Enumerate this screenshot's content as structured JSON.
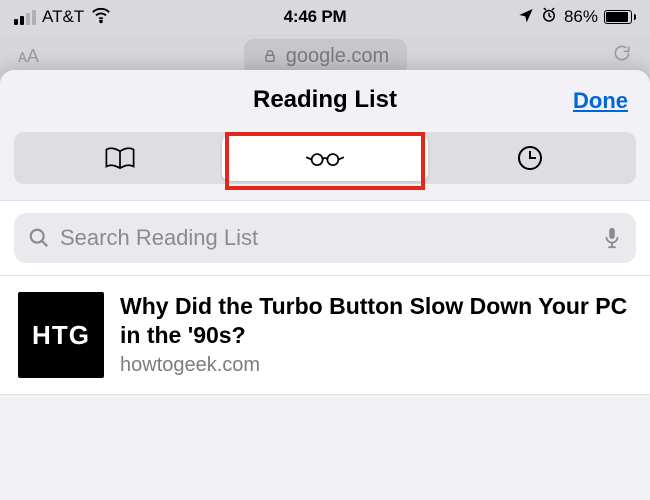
{
  "status": {
    "carrier": "AT&T",
    "time": "4:46 PM",
    "battery_pct": "86%"
  },
  "safari": {
    "url": "google.com"
  },
  "sheet": {
    "title": "Reading List",
    "done_label": "Done"
  },
  "search": {
    "placeholder": "Search Reading List"
  },
  "items": [
    {
      "thumb_text": "HTG",
      "title": "Why Did the Turbo Button Slow Down Your PC in the '90s?",
      "domain": "howtogeek.com"
    }
  ]
}
